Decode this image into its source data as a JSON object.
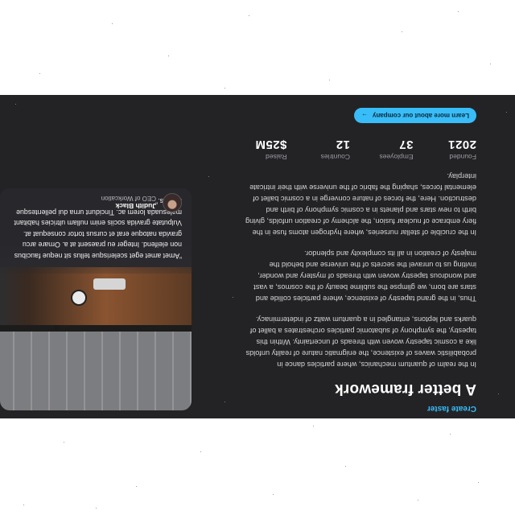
{
  "section": {
    "eyebrow": "Create faster",
    "title": "A better framework",
    "paragraphs": [
      "In the realm of quantum mechanics, where particles dance in probabilistic waves of existence, the enigmatic nature of reality unfolds like a cosmic tapestry woven with threads of uncertainty. Within this tapestry, the symphony of subatomic particles orchestrates a ballet of quarks and leptons, entangled in a quantum waltz of indeterminacy.",
      "Thus, in the grand tapestry of existence, where particles collide and stars are born, we glimpse the sublime beauty of the cosmos, a vast and wondrous tapestry woven with threads of mystery and wonder, inviting us to unravel the secrets of the universe and behold the majesty of creation in all its complexity and splendor.",
      "In the crucible of stellar nurseries, where hydrogen atoms fuse in the fiery embrace of nuclear fusion, the alchemy of creation unfolds, giving birth to new stars and planets in a cosmic symphony of birth and destruction. Here, the forces of nature converge in a cosmic ballet of elemental forces, shaping the fabric of the universe with their intricate interplay."
    ]
  },
  "stats": [
    {
      "label": "Founded",
      "value": "2021"
    },
    {
      "label": "Employees",
      "value": "37"
    },
    {
      "label": "Countries",
      "value": "12"
    },
    {
      "label": "Raised",
      "value": "$25M"
    }
  ],
  "cta": {
    "label": "Learn more about our company",
    "icon": "arrow-right-icon"
  },
  "testimonial": {
    "quote": "“Amet amet eget scelerisque tellus sit neque faucibus non eleifend. Integer eu praesent at a. Ornare arcu gravida natoque erat et cursus tortor consequat at. Vulputate gravida sociis enim nullam ultricies habitant malesuada lorem ac. Tincidunt urna dui pellentesque sagittis.”",
    "author_name": "Judith Black",
    "author_role": "CEO of Workcation"
  },
  "colors": {
    "accent": "#38bdf8",
    "band": "#232326",
    "page": "#ffffff"
  }
}
